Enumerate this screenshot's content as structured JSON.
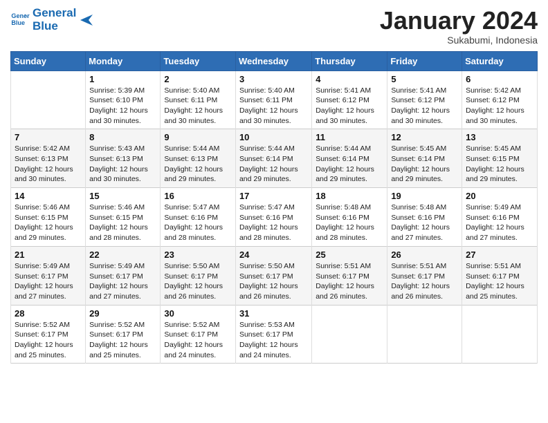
{
  "header": {
    "logo_line1": "General",
    "logo_line2": "Blue",
    "month": "January 2024",
    "location": "Sukabumi, Indonesia"
  },
  "weekdays": [
    "Sunday",
    "Monday",
    "Tuesday",
    "Wednesday",
    "Thursday",
    "Friday",
    "Saturday"
  ],
  "weeks": [
    [
      {
        "day": "",
        "sunrise": "",
        "sunset": "",
        "daylight": ""
      },
      {
        "day": "1",
        "sunrise": "5:39 AM",
        "sunset": "6:10 PM",
        "daylight": "12 hours and 30 minutes."
      },
      {
        "day": "2",
        "sunrise": "5:40 AM",
        "sunset": "6:11 PM",
        "daylight": "12 hours and 30 minutes."
      },
      {
        "day": "3",
        "sunrise": "5:40 AM",
        "sunset": "6:11 PM",
        "daylight": "12 hours and 30 minutes."
      },
      {
        "day": "4",
        "sunrise": "5:41 AM",
        "sunset": "6:12 PM",
        "daylight": "12 hours and 30 minutes."
      },
      {
        "day": "5",
        "sunrise": "5:41 AM",
        "sunset": "6:12 PM",
        "daylight": "12 hours and 30 minutes."
      },
      {
        "day": "6",
        "sunrise": "5:42 AM",
        "sunset": "6:12 PM",
        "daylight": "12 hours and 30 minutes."
      }
    ],
    [
      {
        "day": "7",
        "sunrise": "5:42 AM",
        "sunset": "6:13 PM",
        "daylight": "12 hours and 30 minutes."
      },
      {
        "day": "8",
        "sunrise": "5:43 AM",
        "sunset": "6:13 PM",
        "daylight": "12 hours and 30 minutes."
      },
      {
        "day": "9",
        "sunrise": "5:44 AM",
        "sunset": "6:13 PM",
        "daylight": "12 hours and 29 minutes."
      },
      {
        "day": "10",
        "sunrise": "5:44 AM",
        "sunset": "6:14 PM",
        "daylight": "12 hours and 29 minutes."
      },
      {
        "day": "11",
        "sunrise": "5:44 AM",
        "sunset": "6:14 PM",
        "daylight": "12 hours and 29 minutes."
      },
      {
        "day": "12",
        "sunrise": "5:45 AM",
        "sunset": "6:14 PM",
        "daylight": "12 hours and 29 minutes."
      },
      {
        "day": "13",
        "sunrise": "5:45 AM",
        "sunset": "6:15 PM",
        "daylight": "12 hours and 29 minutes."
      }
    ],
    [
      {
        "day": "14",
        "sunrise": "5:46 AM",
        "sunset": "6:15 PM",
        "daylight": "12 hours and 29 minutes."
      },
      {
        "day": "15",
        "sunrise": "5:46 AM",
        "sunset": "6:15 PM",
        "daylight": "12 hours and 28 minutes."
      },
      {
        "day": "16",
        "sunrise": "5:47 AM",
        "sunset": "6:16 PM",
        "daylight": "12 hours and 28 minutes."
      },
      {
        "day": "17",
        "sunrise": "5:47 AM",
        "sunset": "6:16 PM",
        "daylight": "12 hours and 28 minutes."
      },
      {
        "day": "18",
        "sunrise": "5:48 AM",
        "sunset": "6:16 PM",
        "daylight": "12 hours and 28 minutes."
      },
      {
        "day": "19",
        "sunrise": "5:48 AM",
        "sunset": "6:16 PM",
        "daylight": "12 hours and 27 minutes."
      },
      {
        "day": "20",
        "sunrise": "5:49 AM",
        "sunset": "6:16 PM",
        "daylight": "12 hours and 27 minutes."
      }
    ],
    [
      {
        "day": "21",
        "sunrise": "5:49 AM",
        "sunset": "6:17 PM",
        "daylight": "12 hours and 27 minutes."
      },
      {
        "day": "22",
        "sunrise": "5:49 AM",
        "sunset": "6:17 PM",
        "daylight": "12 hours and 27 minutes."
      },
      {
        "day": "23",
        "sunrise": "5:50 AM",
        "sunset": "6:17 PM",
        "daylight": "12 hours and 26 minutes."
      },
      {
        "day": "24",
        "sunrise": "5:50 AM",
        "sunset": "6:17 PM",
        "daylight": "12 hours and 26 minutes."
      },
      {
        "day": "25",
        "sunrise": "5:51 AM",
        "sunset": "6:17 PM",
        "daylight": "12 hours and 26 minutes."
      },
      {
        "day": "26",
        "sunrise": "5:51 AM",
        "sunset": "6:17 PM",
        "daylight": "12 hours and 26 minutes."
      },
      {
        "day": "27",
        "sunrise": "5:51 AM",
        "sunset": "6:17 PM",
        "daylight": "12 hours and 25 minutes."
      }
    ],
    [
      {
        "day": "28",
        "sunrise": "5:52 AM",
        "sunset": "6:17 PM",
        "daylight": "12 hours and 25 minutes."
      },
      {
        "day": "29",
        "sunrise": "5:52 AM",
        "sunset": "6:17 PM",
        "daylight": "12 hours and 25 minutes."
      },
      {
        "day": "30",
        "sunrise": "5:52 AM",
        "sunset": "6:17 PM",
        "daylight": "12 hours and 24 minutes."
      },
      {
        "day": "31",
        "sunrise": "5:53 AM",
        "sunset": "6:17 PM",
        "daylight": "12 hours and 24 minutes."
      },
      {
        "day": "",
        "sunrise": "",
        "sunset": "",
        "daylight": ""
      },
      {
        "day": "",
        "sunrise": "",
        "sunset": "",
        "daylight": ""
      },
      {
        "day": "",
        "sunrise": "",
        "sunset": "",
        "daylight": ""
      }
    ]
  ],
  "labels": {
    "sunrise_prefix": "Sunrise: ",
    "sunset_prefix": "Sunset: ",
    "daylight_prefix": "Daylight: "
  }
}
